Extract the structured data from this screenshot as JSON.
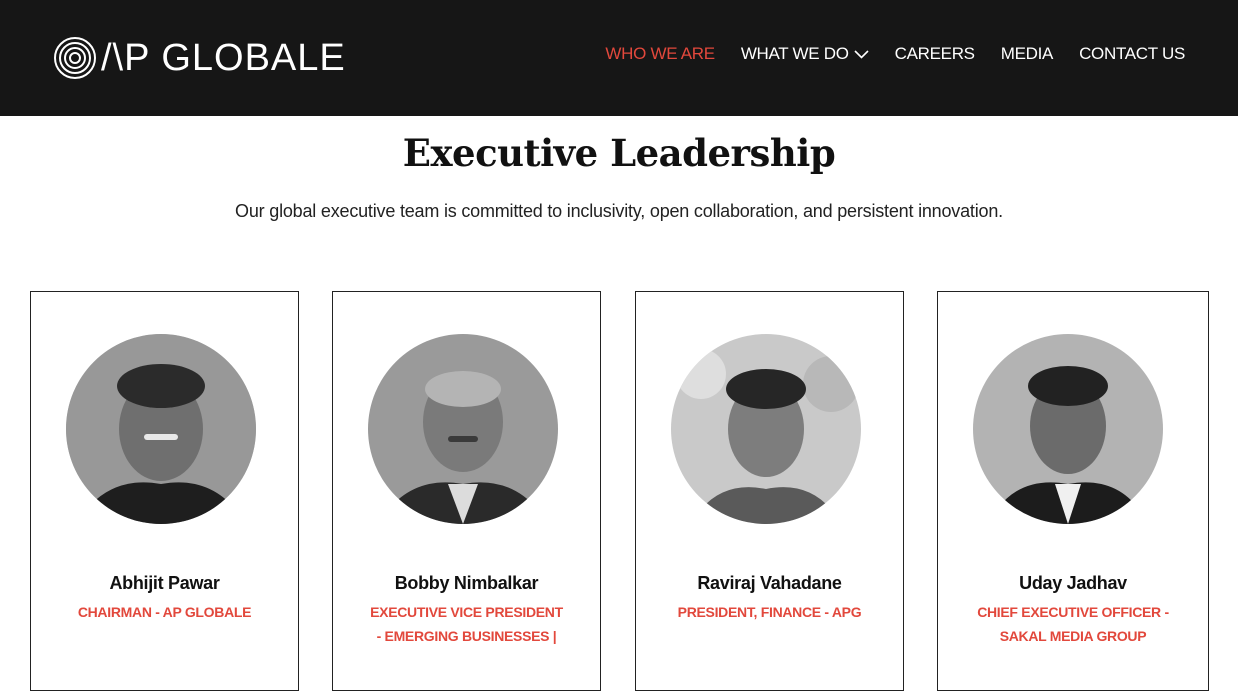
{
  "header": {
    "logo_text": "/\\P GLOBALE",
    "nav": [
      {
        "label": "WHO WE ARE",
        "active": true
      },
      {
        "label": "WHAT WE DO",
        "dropdown": true
      },
      {
        "label": "CAREERS"
      },
      {
        "label": "MEDIA"
      },
      {
        "label": "CONTACT US"
      }
    ]
  },
  "main": {
    "title": "Executive Leadership",
    "subtitle": "Our global executive team is committed to inclusivity, open collaboration, and persistent innovation."
  },
  "leaders": [
    {
      "name": "Abhijit Pawar",
      "role": "CHAIRMAN - AP GLOBALE"
    },
    {
      "name": "Bobby Nimbalkar",
      "role": "EXECUTIVE VICE PRESIDENT - EMERGING BUSINESSES |"
    },
    {
      "name": "Raviraj Vahadane",
      "role": "PRESIDENT, FINANCE - APG"
    },
    {
      "name": "Uday Jadhav",
      "role": "CHIEF EXECUTIVE OFFICER - SAKAL MEDIA GROUP"
    }
  ],
  "colors": {
    "header_bg": "#161616",
    "accent": "#e2483c"
  }
}
